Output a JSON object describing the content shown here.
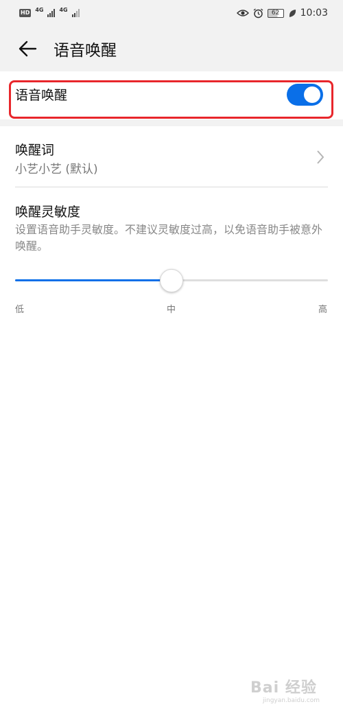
{
  "status_bar": {
    "hd": "HD",
    "network_1": "4G",
    "network_2": "4G",
    "battery": "62",
    "time": "10:03",
    "icons": [
      "eye-icon",
      "alarm-icon",
      "leaf-icon"
    ]
  },
  "header": {
    "title": "语音唤醒",
    "back_icon": "back-arrow-icon"
  },
  "wake": {
    "label": "语音唤醒",
    "enabled": true,
    "highlight_color": "#e8262b"
  },
  "wake_word": {
    "title": "唤醒词",
    "value": "小艺小艺 (默认)"
  },
  "sensitivity": {
    "title": "唤醒灵敏度",
    "description": "设置语音助手灵敏度。不建议灵敏度过高，以免语音助手被意外唤醒。",
    "level": 0.5,
    "low_label": "低",
    "mid_label": "中",
    "high_label": "高"
  },
  "watermark": {
    "main": "Bai 经验",
    "sub": "jingyan.baidu.com"
  },
  "colors": {
    "accent": "#0a6fe8",
    "background_gray": "#f2f2f2"
  }
}
